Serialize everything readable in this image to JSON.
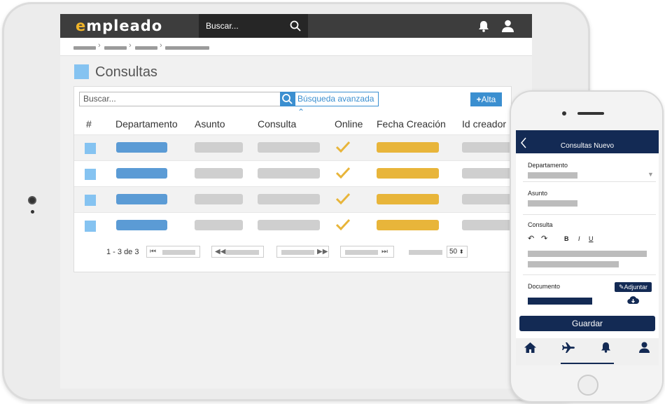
{
  "app": {
    "logo_first": "e",
    "logo_rest": "mpleado"
  },
  "header": {
    "search_placeholder": "Buscar..."
  },
  "page": {
    "title": "Consultas"
  },
  "table_toolbar": {
    "search_placeholder": "Buscar...",
    "advanced_search": "Búsqueda avanzada",
    "add_label": "Alta"
  },
  "table": {
    "columns": [
      "#",
      "Departamento",
      "Asunto",
      "Consulta",
      "Online",
      "Fecha Creación",
      "Id creador"
    ],
    "row_count": 4
  },
  "pagination": {
    "range": "1 - 3 de 3",
    "page_size": "50"
  },
  "mobile": {
    "title": "Consultas Nuevo",
    "department_label": "Departamento",
    "subject_label": "Asunto",
    "query_label": "Consulta",
    "bold": "B",
    "italic": "I",
    "underline": "U",
    "document_label": "Documento",
    "attach_label": "Adjuntar",
    "save_label": "Guardar"
  },
  "colors": {
    "accent": "#3b8fd0",
    "navy": "#132a54",
    "logo_yellow": "#f0b429",
    "date_yellow": "#e8b53a"
  }
}
